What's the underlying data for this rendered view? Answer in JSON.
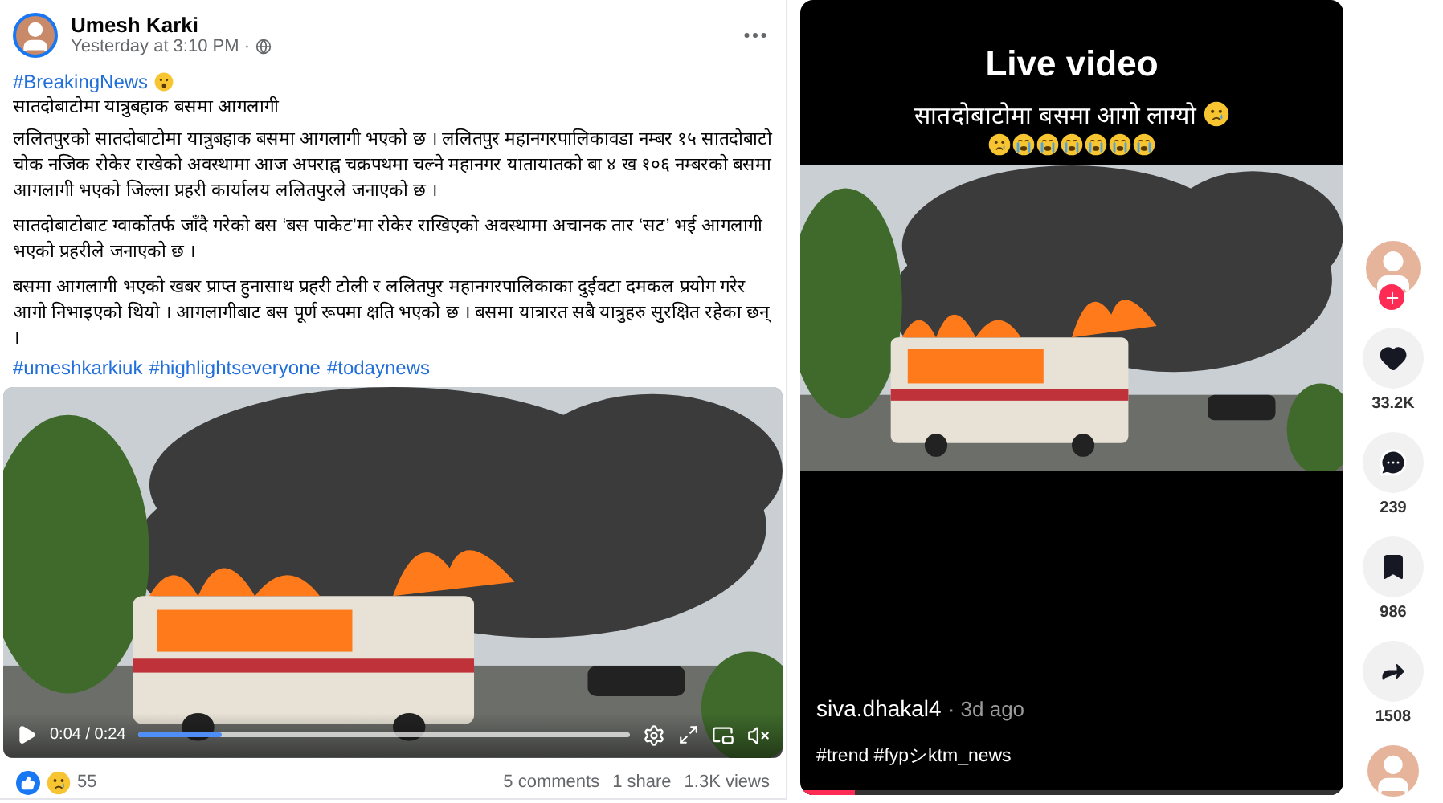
{
  "facebook_post": {
    "author": "Umesh Karki",
    "timestamp": "Yesterday at 3:10 PM ·",
    "headline_tag": "#BreakingNews",
    "title": "सातदोबाटोमा यात्रुबहाक बसमा आगलागी",
    "paragraphs": [
      "ललितपुरको सातदोबाटोमा यात्रुबहाक बसमा आगलागी भएको छ । ललितपुर महानगरपालिकावडा नम्बर १५ सातदोबाटो चोक नजिक रोकेर राखेको अवस्थामा आज अपराह्न चक्रपथमा चल्ने महानगर यातायातको बा ४ ख १०६ नम्बरको बसमा आगलागी भएको जिल्ला प्रहरी कार्यालय ललितपुरले जनाएको छ ।",
      "सातदोबाटोबाट ग्वार्कोतर्फ जाँदै गरेको बस ‘बस पाकेट’मा रोकेर राखिएको अवस्थामा अचानक तार ‘सट’ भई आगलागी भएको प्रहरीले जनाएको छ ।",
      "बसमा आगलागी भएको खबर प्राप्त हुनासाथ प्रहरी टोली र ललितपुर महानगरपालिकाका दुईवटा दमकल प्रयोग गरेर आगो निभाइएको थियो । आगलागीबाट बस पूर्ण रूपमा क्षति भएको छ । बसमा यात्रारत सबै यात्रुहरु सुरक्षित रहेका छन् ।"
    ],
    "hashtags": [
      "#umeshkarkiuk",
      "#highlightseveryone",
      "#todaynews"
    ],
    "video": {
      "time": "0:04 / 0:24",
      "progress": {
        "level": 0.17
      }
    },
    "reactions": {
      "count": "55"
    },
    "stats": [
      "5 comments",
      "1 share",
      "1.3K views"
    ]
  },
  "tiktok_post": {
    "overlay_title": "Live video",
    "overlay_caption": "सातदोबाटोमा बसमा आगो लाग्यो",
    "username": "siva.dhakal4",
    "posted": "· 3d ago",
    "caption": "#trend #fypシktm_news",
    "progress": {
      "level": 0.1
    },
    "actions": [
      {
        "kind": "like",
        "count": "33.2K"
      },
      {
        "kind": "comment",
        "count": "239"
      },
      {
        "kind": "bookmark",
        "count": "986"
      },
      {
        "kind": "share",
        "count": "1508"
      }
    ]
  }
}
